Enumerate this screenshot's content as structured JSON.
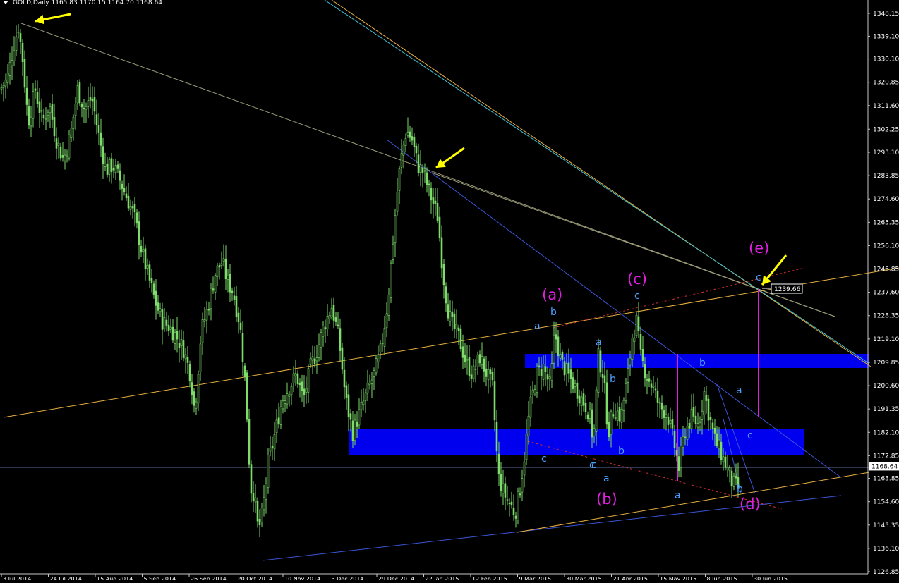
{
  "header": {
    "symbol_line": "GOLD,Daily  1165.83 1170.15 1164.70 1168.64"
  },
  "colors": {
    "background": "#000000",
    "candle_up": "#7ddc6a",
    "candle_down": "#7ddc6a",
    "zone": "#0000ee",
    "arrow": "#ffff00",
    "wave_major": "#e020e0",
    "wave_minor": "#4aa0ff",
    "trend_grey": "#9c9c7a",
    "trend_blue": "#3a55d8",
    "trend_orange": "#e8b040",
    "trend_cyan": "#40c0d0",
    "trend_red": "#d03030",
    "measure_magenta": "#e020e0"
  },
  "chart_data": {
    "type": "candlestick",
    "title": "",
    "y_axis_ticks": [
      "1348.15",
      "1339.10",
      "1330.10",
      "1320.85",
      "1311.60",
      "1302.25",
      "1293.10",
      "1283.85",
      "1274.60",
      "1265.35",
      "1256.10",
      "1246.85",
      "1237.60",
      "1228.35",
      "1219.10",
      "1209.85",
      "1200.60",
      "1191.35",
      "1182.10",
      "1172.85",
      "1163.85",
      "1154.60",
      "1145.35",
      "1136.10",
      "1126.85"
    ],
    "ylim": [
      1126.85,
      1348.15
    ],
    "current_price": "1168.64",
    "price_label": "1239.66",
    "x_axis_ticks": [
      "3 Jul 2014",
      "24 Jul 2014",
      "15 Aug 2014",
      "5 Sep 2014",
      "26 Sep 2014",
      "20 Oct 2014",
      "10 Nov 2014",
      "3 Dec 2014",
      "29 Dec 2014",
      "22 Jan 2015",
      "12 Feb 2015",
      "9 Mar 2015",
      "30 Mar 2015",
      "21 Apr 2015",
      "15 May 2015",
      "8 Jun 2015",
      "30 Jun 2015"
    ],
    "close_path": [
      [
        0,
        1318
      ],
      [
        10,
        1322
      ],
      [
        20,
        1336
      ],
      [
        26,
        1343
      ],
      [
        32,
        1330
      ],
      [
        40,
        1305
      ],
      [
        50,
        1318
      ],
      [
        60,
        1305
      ],
      [
        70,
        1312
      ],
      [
        80,
        1298
      ],
      [
        90,
        1290
      ],
      [
        100,
        1300
      ],
      [
        110,
        1318
      ],
      [
        120,
        1310
      ],
      [
        130,
        1315
      ],
      [
        140,
        1300
      ],
      [
        150,
        1286
      ],
      [
        160,
        1288
      ],
      [
        170,
        1282
      ],
      [
        180,
        1275
      ],
      [
        190,
        1268
      ],
      [
        200,
        1255
      ],
      [
        210,
        1244
      ],
      [
        220,
        1234
      ],
      [
        230,
        1226
      ],
      [
        240,
        1224
      ],
      [
        250,
        1220
      ],
      [
        260,
        1215
      ],
      [
        270,
        1205
      ],
      [
        276,
        1190
      ],
      [
        285,
        1222
      ],
      [
        295,
        1232
      ],
      [
        305,
        1245
      ],
      [
        315,
        1250
      ],
      [
        322,
        1242
      ],
      [
        330,
        1238
      ],
      [
        340,
        1225
      ],
      [
        348,
        1200
      ],
      [
        355,
        1160
      ],
      [
        360,
        1158
      ],
      [
        366,
        1143
      ],
      [
        372,
        1150
      ],
      [
        380,
        1170
      ],
      [
        390,
        1182
      ],
      [
        400,
        1195
      ],
      [
        410,
        1200
      ],
      [
        420,
        1205
      ],
      [
        430,
        1195
      ],
      [
        440,
        1208
      ],
      [
        450,
        1215
      ],
      [
        460,
        1225
      ],
      [
        470,
        1232
      ],
      [
        480,
        1220
      ],
      [
        490,
        1195
      ],
      [
        500,
        1182
      ],
      [
        510,
        1190
      ],
      [
        520,
        1198
      ],
      [
        530,
        1205
      ],
      [
        540,
        1215
      ],
      [
        550,
        1235
      ],
      [
        556,
        1255
      ],
      [
        562,
        1275
      ],
      [
        568,
        1290
      ],
      [
        576,
        1302
      ],
      [
        584,
        1298
      ],
      [
        592,
        1288
      ],
      [
        600,
        1285
      ],
      [
        610,
        1276
      ],
      [
        620,
        1268
      ],
      [
        628,
        1245
      ],
      [
        634,
        1232
      ],
      [
        640,
        1225
      ],
      [
        650,
        1220
      ],
      [
        660,
        1210
      ],
      [
        670,
        1205
      ],
      [
        680,
        1212
      ],
      [
        690,
        1205
      ],
      [
        698,
        1200
      ],
      [
        706,
        1165
      ],
      [
        714,
        1158
      ],
      [
        722,
        1154
      ],
      [
        730,
        1150
      ],
      [
        736,
        1158
      ],
      [
        742,
        1170
      ],
      [
        750,
        1190
      ],
      [
        760,
        1205
      ],
      [
        770,
        1208
      ],
      [
        780,
        1200
      ],
      [
        786,
        1222
      ],
      [
        795,
        1210
      ],
      [
        805,
        1205
      ],
      [
        815,
        1200
      ],
      [
        825,
        1195
      ],
      [
        835,
        1190
      ],
      [
        841,
        1178
      ],
      [
        848,
        1212
      ],
      [
        855,
        1205
      ],
      [
        862,
        1182
      ],
      [
        870,
        1192
      ],
      [
        880,
        1188
      ],
      [
        890,
        1205
      ],
      [
        896,
        1220
      ],
      [
        902,
        1226
      ],
      [
        908,
        1212
      ],
      [
        916,
        1205
      ],
      [
        925,
        1200
      ],
      [
        935,
        1192
      ],
      [
        945,
        1190
      ],
      [
        955,
        1178
      ],
      [
        962,
        1168
      ],
      [
        970,
        1182
      ],
      [
        980,
        1188
      ],
      [
        990,
        1185
      ],
      [
        998,
        1198
      ],
      [
        1004,
        1190
      ],
      [
        1012,
        1180
      ],
      [
        1020,
        1175
      ],
      [
        1030,
        1168
      ],
      [
        1038,
        1162
      ],
      [
        1046,
        1160
      ]
    ],
    "wave_labels_major": [
      "(a)",
      "(b)",
      "(c)",
      "(d)",
      "(e)"
    ],
    "wave_labels_minor": [
      "a",
      "b",
      "c",
      "a",
      "b",
      "c",
      "a",
      "b",
      "c",
      "a",
      "b",
      "c",
      "a",
      "b",
      "c",
      "c"
    ]
  }
}
